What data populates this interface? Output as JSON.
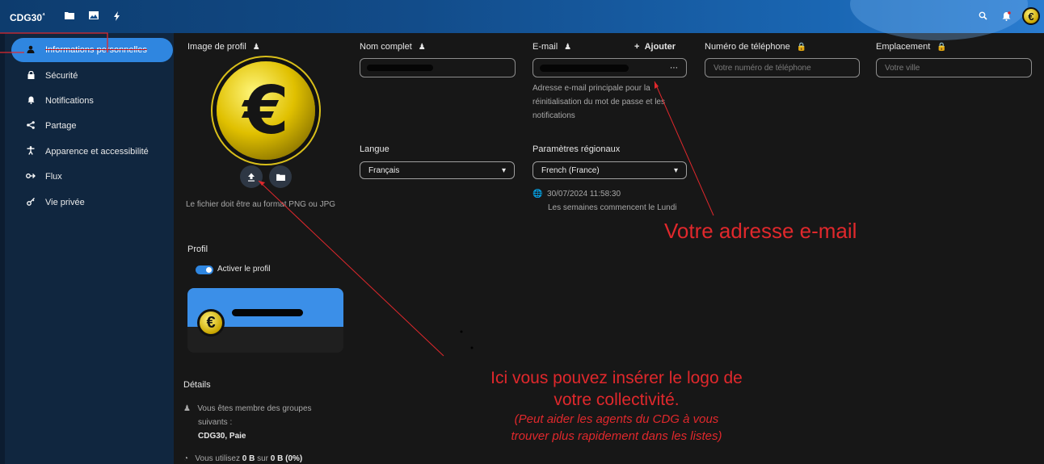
{
  "app": {
    "logo": "CDG30",
    "logo_sup": "⁴"
  },
  "topbar": {
    "icons": [
      "folder-icon",
      "image-icon",
      "bolt-icon",
      "search-icon",
      "bell-icon",
      "avatar"
    ]
  },
  "sidebar": {
    "items": [
      {
        "label": "Informations personnelles",
        "icon": "person-icon",
        "active": true
      },
      {
        "label": "Sécurité",
        "icon": "lock-icon"
      },
      {
        "label": "Notifications",
        "icon": "bell-icon"
      },
      {
        "label": "Partage",
        "icon": "share-icon"
      },
      {
        "label": "Apparence et accessibilité",
        "icon": "accessibility-icon"
      },
      {
        "label": "Flux",
        "icon": "flow-icon"
      },
      {
        "label": "Vie privée",
        "icon": "key-icon"
      }
    ]
  },
  "profile_image": {
    "label": "Image de profil",
    "hint": "Le fichier doit être au format PNG ou JPG"
  },
  "fullname": {
    "label": "Nom complet"
  },
  "email": {
    "label": "E-mail",
    "add": "Ajouter",
    "help_1": "Adresse e-mail principale pour la",
    "help_2": "réinitialisation du mot de passe et les",
    "help_3": "notifications"
  },
  "phone": {
    "label": "Numéro de téléphone",
    "placeholder": "Votre numéro de téléphone"
  },
  "location": {
    "label": "Emplacement",
    "placeholder": "Votre ville"
  },
  "language": {
    "label": "Langue",
    "value": "Français"
  },
  "locale": {
    "label": "Paramètres régionaux",
    "value": "French (France)",
    "datetime": "30/07/2024 11:58:30",
    "week": "Les semaines commencent le Lundi"
  },
  "profile": {
    "label": "Profil",
    "toggle_label": "Activer le profil"
  },
  "details": {
    "label": "Détails",
    "groups_1": "Vous êtes membre des groupes",
    "groups_2": "suivants :",
    "groups_value": "CDG30, Paie",
    "usage_pre": "Vous utilisez",
    "usage_used": "0 B",
    "usage_mid": "sur",
    "usage_total": "0 B",
    "usage_pct": "(0%)"
  },
  "annotations": {
    "email_note": "Votre adresse e-mail",
    "logo_line1": "Ici vous pouvez insérer le logo de",
    "logo_line2": "votre collectivité.",
    "logo_line3": "(Peut aider les agents du CDG à vous",
    "logo_line4": "trouver plus rapidement dans les listes)"
  },
  "colors": {
    "accent": "#2f86e0",
    "annotation": "#e0282c",
    "sidebar": "#10263f",
    "background": "#171717"
  }
}
